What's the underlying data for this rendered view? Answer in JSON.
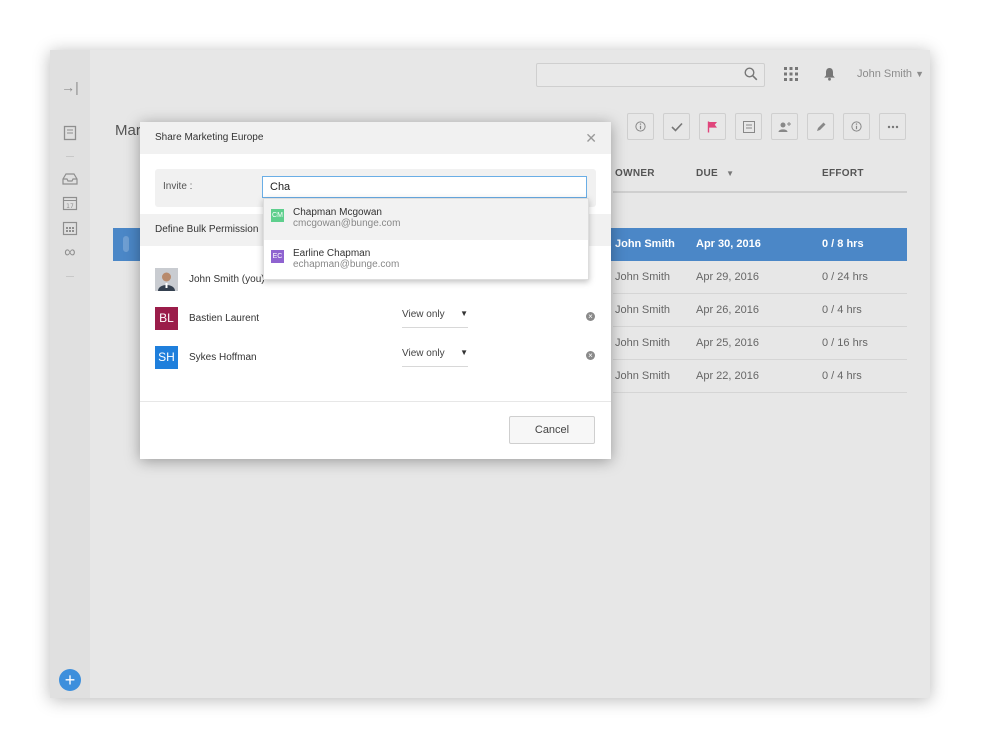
{
  "user": {
    "name": "John Smith"
  },
  "page": {
    "title_fragment": "Mar"
  },
  "table": {
    "columns": [
      {
        "key": "owner",
        "label": "OWNER"
      },
      {
        "key": "due",
        "label": "DUE"
      },
      {
        "key": "effort",
        "label": "EFFORT"
      }
    ],
    "rows": [
      {
        "owner": "John Smith",
        "due": "Apr 30, 2016",
        "effort": "0 / 8  hrs",
        "selected": true
      },
      {
        "owner": "John Smith",
        "due": "Apr 29, 2016",
        "effort": "0 / 24  hrs",
        "selected": false
      },
      {
        "owner": "John Smith",
        "due": "Apr 26, 2016",
        "effort": "0 / 4  hrs",
        "selected": false
      },
      {
        "owner": "John Smith",
        "due": "Apr 25, 2016",
        "effort": "0 / 16  hrs",
        "selected": false
      },
      {
        "owner": "John Smith",
        "due": "Apr 22, 2016",
        "effort": "0 / 4  hrs",
        "selected": false
      }
    ]
  },
  "toolbar": {
    "icons": [
      "info-icon",
      "check-icon",
      "flag-icon",
      "checklist-icon",
      "add-user-icon",
      "pencil-icon",
      "info-icon-2",
      "more-icon"
    ],
    "flag_color": "#e0457b"
  },
  "modal": {
    "title": "Share Marketing Europe",
    "invite_label": "Invite :",
    "invite_value": "Cha",
    "bulk_label": "Define Bulk Permission",
    "cancel_label": "Cancel",
    "members": [
      {
        "name": "John Smith (you)",
        "avatar_type": "photo",
        "initials": ""
      },
      {
        "name": "Bastien Laurent",
        "avatar_type": "initials",
        "initials": "BL",
        "color": "#9b1d4a",
        "permission": "View only"
      },
      {
        "name": "Sykes Hoffman",
        "avatar_type": "initials",
        "initials": "SH",
        "color": "#1f7fdc",
        "permission": "View only"
      }
    ]
  },
  "suggestions": [
    {
      "name": "Chapman Mcgowan",
      "email": "cmcgowan@bunge.com",
      "initials": "CM",
      "color": "#5ecf8d"
    },
    {
      "name": "Earline Chapman",
      "email": "echapman@bunge.com",
      "initials": "EC",
      "color": "#8f63d0"
    }
  ],
  "colors": {
    "accent": "#3d8fdc",
    "selected_row": "#4b87c7"
  }
}
